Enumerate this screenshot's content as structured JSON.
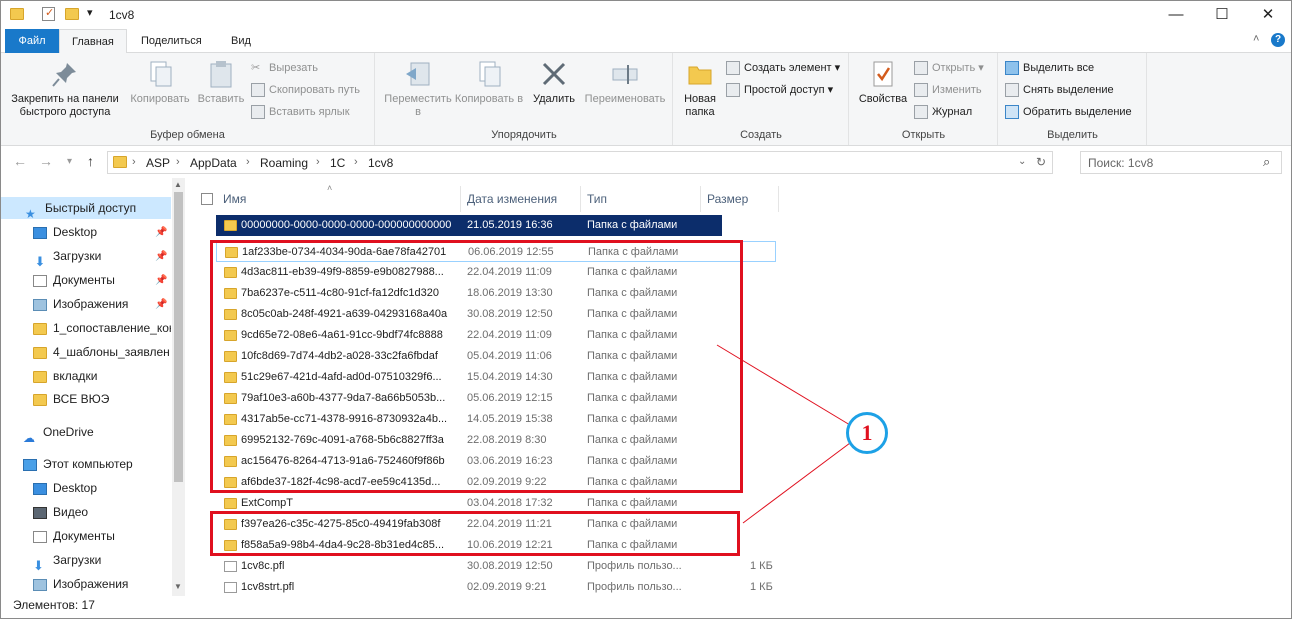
{
  "window": {
    "title": "1cv8",
    "minimize": "—",
    "maximize": "☐",
    "close": "✕",
    "qat_dropdown": "▾"
  },
  "tabs": [
    {
      "label": "Файл"
    },
    {
      "label": "Главная"
    },
    {
      "label": "Поделиться"
    },
    {
      "label": "Вид"
    }
  ],
  "ribbon": {
    "clipboard": {
      "group_label": "Буфер обмена",
      "pin_label": "Закрепить на панели быстрого доступа",
      "copy_label": "Копировать",
      "paste_label": "Вставить",
      "cut_label": "Вырезать",
      "copy_path_label": "Скопировать путь",
      "paste_shortcut_label": "Вставить ярлык"
    },
    "organize": {
      "group_label": "Упорядочить",
      "move_label": "Переместить в",
      "copy_to_label": "Копировать в",
      "delete_label": "Удалить",
      "rename_label": "Переименовать"
    },
    "create": {
      "group_label": "Создать",
      "new_folder_label": "Новая папка",
      "new_item_label": "Создать элемент",
      "easy_access_label": "Простой доступ"
    },
    "open": {
      "group_label": "Открыть",
      "properties_label": "Свойства",
      "open_label": "Открыть",
      "edit_label": "Изменить",
      "history_label": "Журнал"
    },
    "select": {
      "group_label": "Выделить",
      "select_all_label": "Выделить все",
      "select_none_label": "Снять выделение",
      "invert_label": "Обратить выделение"
    }
  },
  "address": {
    "crumbs": [
      "ASP",
      "AppData",
      "Roaming",
      "1C",
      "1cv8"
    ],
    "search_placeholder": "Поиск: 1cv8"
  },
  "nav": {
    "quick_access": "Быстрый доступ",
    "quick_items": [
      "Desktop",
      "Загрузки",
      "Документы",
      "Изображения",
      "1_сопоставление_кон",
      "4_шаблоны_заявлен",
      "вкладки",
      "ВСЕ ВЮЭ"
    ],
    "onedrive": "OneDrive",
    "this_pc": "Этот компьютер",
    "pc_items": [
      "Desktop",
      "Видео",
      "Документы",
      "Загрузки",
      "Изображения"
    ]
  },
  "columns": {
    "name": "Имя",
    "date": "Дата изменения",
    "type": "Тип",
    "size": "Размер"
  },
  "files": [
    {
      "name": "00000000-0000-0000-0000-000000000000",
      "date": "21.05.2019 16:36",
      "type": "Папка с файлами",
      "size": ""
    },
    {
      "name": "1af233be-0734-4034-90da-6ae78fa42701",
      "date": "06.06.2019 12:55",
      "type": "Папка с файлами",
      "size": ""
    },
    {
      "name": "4d3ac811-eb39-49f9-8859-e9b0827988...",
      "date": "22.04.2019 11:09",
      "type": "Папка с файлами",
      "size": ""
    },
    {
      "name": "7ba6237e-c511-4c80-91cf-fa12dfc1d320",
      "date": "18.06.2019 13:30",
      "type": "Папка с файлами",
      "size": ""
    },
    {
      "name": "8c05c0ab-248f-4921-a639-04293168a40a",
      "date": "30.08.2019 12:50",
      "type": "Папка с файлами",
      "size": ""
    },
    {
      "name": "9cd65e72-08e6-4a61-91cc-9bdf74fc8888",
      "date": "22.04.2019 11:09",
      "type": "Папка с файлами",
      "size": ""
    },
    {
      "name": "10fc8d69-7d74-4db2-a028-33c2fa6fbdaf",
      "date": "05.04.2019 11:06",
      "type": "Папка с файлами",
      "size": ""
    },
    {
      "name": "51c29e67-421d-4afd-ad0d-07510329f6...",
      "date": "15.04.2019 14:30",
      "type": "Папка с файлами",
      "size": ""
    },
    {
      "name": "79af10e3-a60b-4377-9da7-8a66b5053b...",
      "date": "05.06.2019 12:15",
      "type": "Папка с файлами",
      "size": ""
    },
    {
      "name": "4317ab5e-cc71-4378-9916-8730932a4b...",
      "date": "14.05.2019 15:38",
      "type": "Папка с файлами",
      "size": ""
    },
    {
      "name": "69952132-769c-4091-a768-5b6c8827ff3a",
      "date": "22.08.2019 8:30",
      "type": "Папка с файлами",
      "size": ""
    },
    {
      "name": "ac156476-8264-4713-91a6-752460f9f86b",
      "date": "03.06.2019 16:23",
      "type": "Папка с файлами",
      "size": ""
    },
    {
      "name": "af6bde37-182f-4c98-acd7-ee59c4135d...",
      "date": "02.09.2019 9:22",
      "type": "Папка с файлами",
      "size": ""
    },
    {
      "name": "ExtCompT",
      "date": "03.04.2018 17:32",
      "type": "Папка с файлами",
      "size": ""
    },
    {
      "name": "f397ea26-c35c-4275-85c0-49419fab308f",
      "date": "22.04.2019 11:21",
      "type": "Папка с файлами",
      "size": ""
    },
    {
      "name": "f858a5a9-98b4-4da4-9c28-8b31ed4c85...",
      "date": "10.06.2019 12:21",
      "type": "Папка с файлами",
      "size": ""
    },
    {
      "name": "1cv8c.pfl",
      "date": "30.08.2019 12:50",
      "type": "Профиль пользо...",
      "size": "1 КБ"
    },
    {
      "name": "1cv8strt.pfl",
      "date": "02.09.2019 9:21",
      "type": "Профиль пользо...",
      "size": "1 КБ"
    }
  ],
  "status": "Элементов: 17",
  "annotation": "1"
}
